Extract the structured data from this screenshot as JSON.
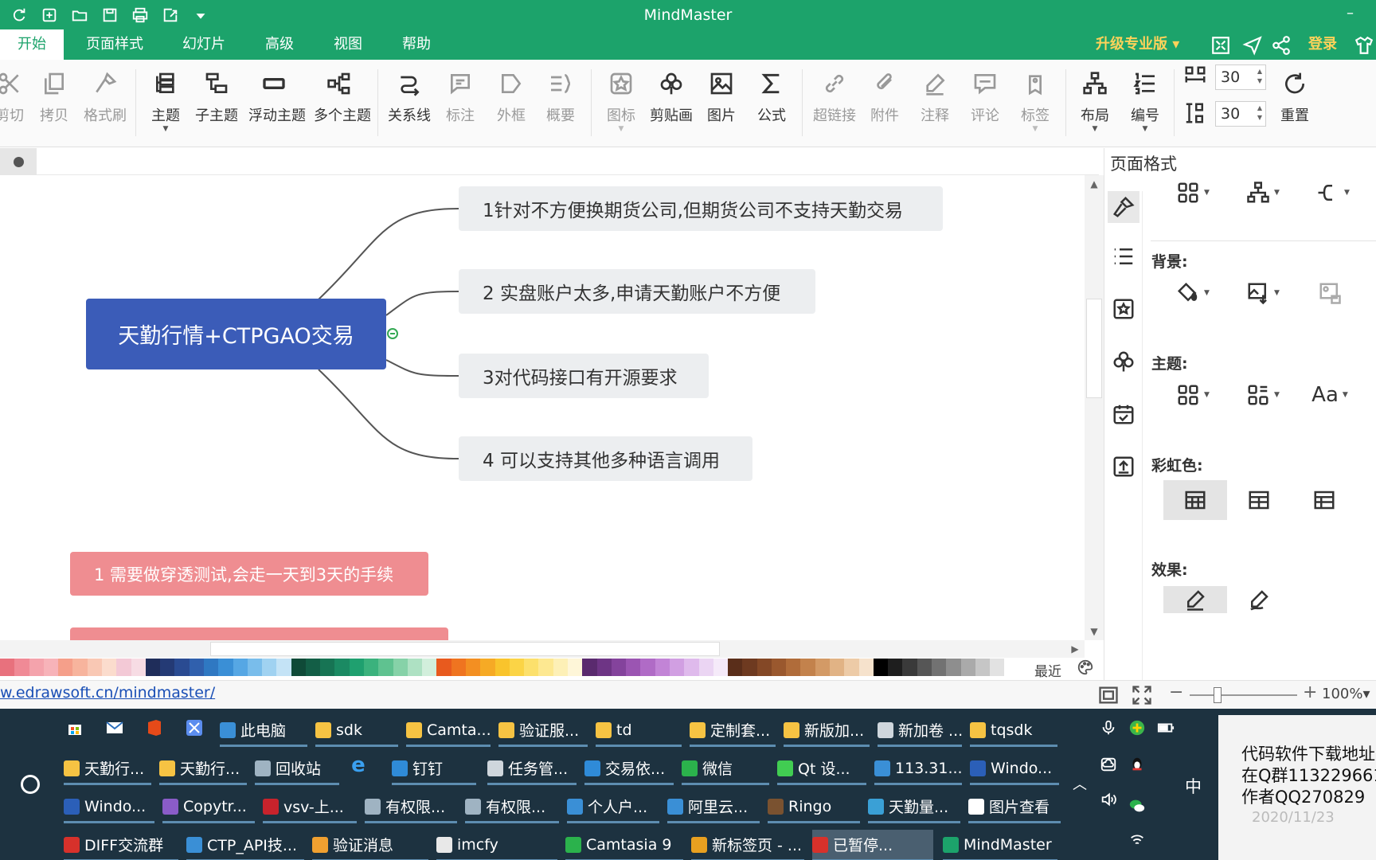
{
  "app": {
    "title": "MindMaster"
  },
  "menu": {
    "tabs": [
      {
        "label": "开始",
        "active": true
      },
      {
        "label": "页面样式"
      },
      {
        "label": "幻灯片"
      },
      {
        "label": "高级"
      },
      {
        "label": "视图"
      },
      {
        "label": "帮助"
      }
    ],
    "upgrade": "升级专业版",
    "login": "登录"
  },
  "ribbon": {
    "buttons": [
      {
        "label": "剪切",
        "icon": "scissors-icon",
        "dim": true
      },
      {
        "label": "拷贝",
        "icon": "copy-icon",
        "dim": true
      },
      {
        "label": "格式刷",
        "icon": "format-brush-icon",
        "dim": true
      },
      {
        "label": "主题",
        "icon": "topic-icon",
        "dim": false
      },
      {
        "label": "子主题",
        "icon": "subtopic-icon",
        "dim": false
      },
      {
        "label": "浮动主题",
        "icon": "floating-topic-icon",
        "dim": false
      },
      {
        "label": "多个主题",
        "icon": "multiple-topics-icon",
        "dim": false
      },
      {
        "label": "关系线",
        "icon": "relationship-icon",
        "dim": false
      },
      {
        "label": "标注",
        "icon": "callout-icon",
        "dim": true
      },
      {
        "label": "外框",
        "icon": "boundary-icon",
        "dim": true
      },
      {
        "label": "概要",
        "icon": "summary-icon",
        "dim": true
      },
      {
        "label": "图标",
        "icon": "mark-icon",
        "dim": true
      },
      {
        "label": "剪贴画",
        "icon": "clipart-icon",
        "dim": false
      },
      {
        "label": "图片",
        "icon": "picture-icon",
        "dim": false
      },
      {
        "label": "公式",
        "icon": "formula-icon",
        "dim": false
      },
      {
        "label": "超链接",
        "icon": "hyperlink-icon",
        "dim": true
      },
      {
        "label": "附件",
        "icon": "attachment-icon",
        "dim": true
      },
      {
        "label": "注释",
        "icon": "note-icon",
        "dim": true
      },
      {
        "label": "评论",
        "icon": "comment-icon",
        "dim": true
      },
      {
        "label": "标签",
        "icon": "tag-icon",
        "dim": true
      },
      {
        "label": "布局",
        "icon": "layout-icon",
        "dim": false
      },
      {
        "label": "编号",
        "icon": "numbering-icon",
        "dim": false
      }
    ],
    "spacing_h": "30",
    "spacing_v": "30",
    "reset": "重置"
  },
  "mindmap": {
    "central": "天勤行情+CTPGAO交易",
    "topics": [
      "1针对不方便换期货公司,但期货公司不支持天勤交易",
      "2 实盘账户太多,申请天勤账户不方便",
      "3对代码接口有开源要求",
      "4 可以支持其他多种语言调用"
    ],
    "floating": [
      "1 需要做穿透测试,会走一天到3天的手续"
    ]
  },
  "palette": {
    "recent": "最近",
    "colors": [
      "#e8717d",
      "#f08a96",
      "#f4a3ac",
      "#f7b3b9",
      "#f59f8a",
      "#f7b49d",
      "#f9c8b4",
      "#fbdccd",
      "#f3c9d6",
      "#f7dce4",
      "#1f2d5a",
      "#243a75",
      "#2a4b92",
      "#3060ad",
      "#2f78c2",
      "#3a8fd6",
      "#56a7e4",
      "#79bdeb",
      "#a0d2f1",
      "#c4e3f6",
      "#0f4a38",
      "#135e46",
      "#177454",
      "#1b8a63",
      "#1fa06f",
      "#3bb27d",
      "#5fc290",
      "#86d2a8",
      "#aee1c3",
      "#d2efdc",
      "#e85a1e",
      "#ef7420",
      "#f38f22",
      "#f6aa25",
      "#f9c42c",
      "#fbd446",
      "#fce06c",
      "#fde891",
      "#fdf0b6",
      "#fef6d8",
      "#5a2a6e",
      "#6e3585",
      "#84439c",
      "#9b55b2",
      "#b06bc6",
      "#c284d6",
      "#d19fe2",
      "#dfbaec",
      "#ebd5f3",
      "#f5eaf9",
      "#5a2e1a",
      "#6e3a20",
      "#844826",
      "#9a582e",
      "#b06c3a",
      "#c3824c",
      "#d39a66",
      "#e1b385",
      "#edcba7",
      "#f6e2cc",
      "#000000",
      "#1e1e1e",
      "#3a3a3a",
      "#565656",
      "#727272",
      "#8e8e8e",
      "#aaaaaa",
      "#c6c6c6",
      "#e2e2e2",
      "#ffffff"
    ]
  },
  "panel": {
    "title": "页面格式",
    "background_label": "背景:",
    "theme_label": "主题:",
    "rainbow_label": "彩虹色:",
    "effects_label": "效果:"
  },
  "status": {
    "url": "w.edrawsoft.cn/mindmaster/",
    "zoom": "100%"
  },
  "taskbar": {
    "row1": [
      {
        "label": "此电脑",
        "color": "#3a8fd6"
      },
      {
        "label": "sdk",
        "color": "#f6c343"
      },
      {
        "label": "Camta...",
        "color": "#f6c343"
      },
      {
        "label": "验证服...",
        "color": "#f6c343"
      },
      {
        "label": "td",
        "color": "#f6c343"
      },
      {
        "label": "定制套...",
        "color": "#f6c343"
      },
      {
        "label": "新版加...",
        "color": "#f6c343"
      },
      {
        "label": "新加卷 ...",
        "color": "#cfd6dc"
      },
      {
        "label": "tqsdk",
        "color": "#f6c343"
      }
    ],
    "row2": [
      {
        "label": "天勤行...",
        "color": "#f6c343"
      },
      {
        "label": "天勤行...",
        "color": "#f6c343"
      },
      {
        "label": "回收站",
        "color": "#9fb3c2"
      },
      {
        "label": "钉钉",
        "color": "#2f8bd8"
      },
      {
        "label": "任务管...",
        "color": "#cfd6dc"
      },
      {
        "label": "交易依...",
        "color": "#2f8bd8"
      },
      {
        "label": "微信",
        "color": "#2bb24c"
      },
      {
        "label": "Qt 设...",
        "color": "#41cd52"
      },
      {
        "label": "113.31...",
        "color": "#3a8fd6"
      },
      {
        "label": "Windo...",
        "color": "#2b5fb8"
      }
    ],
    "row3": [
      {
        "label": "Windo...",
        "color": "#2b5fb8"
      },
      {
        "label": "Copytr...",
        "color": "#8a5cc8"
      },
      {
        "label": "vsv-上...",
        "color": "#c8232c"
      },
      {
        "label": "有权限...",
        "color": "#9fb3c2"
      },
      {
        "label": "有权限...",
        "color": "#9fb3c2"
      },
      {
        "label": "个人户...",
        "color": "#3a8fd6"
      },
      {
        "label": "阿里云...",
        "color": "#3a8fd6"
      },
      {
        "label": "Ringo",
        "color": "#7a5230"
      },
      {
        "label": "天勤量...",
        "color": "#3aa0d6"
      },
      {
        "label": "图片查看",
        "color": "#ffffff"
      }
    ],
    "row4": [
      {
        "label": "DIFF交流群",
        "color": "#d7312b"
      },
      {
        "label": "CTP_API技...",
        "color": "#3a8fd6"
      },
      {
        "label": "验证消息",
        "color": "#f0a030"
      },
      {
        "label": "imcfy",
        "color": "#e8e8e8"
      },
      {
        "label": "Camtasia 9",
        "color": "#2bb24c"
      },
      {
        "label": "新标签页 - ...",
        "color": "#e8a020"
      },
      {
        "label": "已暂停...",
        "color": "#d7312b",
        "active": true
      },
      {
        "label": "MindMaster",
        "color": "#1ca36b"
      }
    ],
    "ime": "中",
    "notification": {
      "lines": [
        "代码软件下载地址",
        "在Q群113229661",
        "作者QQ270829"
      ],
      "date": "2020/11/23"
    }
  }
}
